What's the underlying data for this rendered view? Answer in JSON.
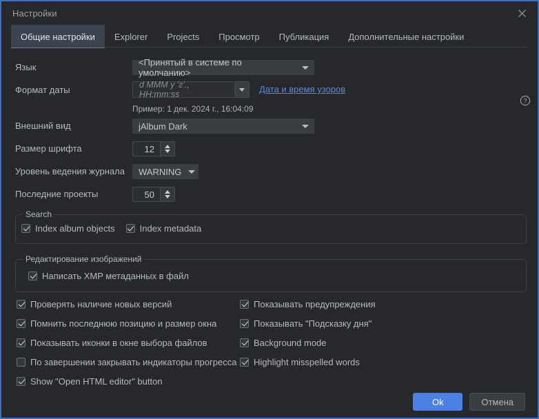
{
  "window": {
    "title": "Настройки",
    "close_icon": "close-icon",
    "help_icon": "help-circle-icon",
    "accent_color": "#4d80e4",
    "background_color": "#26282c",
    "border_color": "#3d6fc4"
  },
  "tabs": [
    {
      "label": "Общие настройки",
      "active": true
    },
    {
      "label": "Explorer",
      "active": false
    },
    {
      "label": "Projects",
      "active": false
    },
    {
      "label": "Просмотр",
      "active": false
    },
    {
      "label": "Публикация",
      "active": false
    },
    {
      "label": "Дополнительные настройки",
      "active": false
    }
  ],
  "fields": {
    "language": {
      "label": "Язык",
      "value": "<Принятый в системе по умолчанию>"
    },
    "date_format": {
      "label": "Формат даты",
      "value": "d MMM y 'г'., HH:mm:ss",
      "link": "Дата и время узоров",
      "example": "Пример: 1 дек. 2024 г., 16:04:09"
    },
    "look_and_feel": {
      "label": "Внешний вид",
      "value": "jAlbum Dark"
    },
    "font_size": {
      "label": "Размер шрифта",
      "value": "12"
    },
    "log_level": {
      "label": "Уровень ведения журнала",
      "value": "WARNING"
    },
    "recent_projects": {
      "label": "Последние проекты",
      "value": "50"
    }
  },
  "search_group": {
    "title": "Search",
    "items": [
      {
        "label": "Index album objects",
        "checked": true
      },
      {
        "label": "Index metadata",
        "checked": true
      }
    ]
  },
  "image_editing_group": {
    "title": "Редактирование изображений",
    "items": [
      {
        "label": "Написать XMP метаданных в файл",
        "checked": true
      }
    ]
  },
  "options_left": [
    {
      "label": "Проверять наличие новых версий",
      "checked": true
    },
    {
      "label": "Помнить последнюю позицию и размер окна",
      "checked": true
    },
    {
      "label": "Показывать иконки в окне выбора файлов",
      "checked": true
    },
    {
      "label": "По завершении закрывать индикаторы прогресса",
      "checked": false
    },
    {
      "label": "Show \"Open HTML editor\" button",
      "checked": true
    }
  ],
  "options_right": [
    {
      "label": "Показывать предупреждения",
      "checked": true
    },
    {
      "label": "Показывать \"Подсказку дня\"",
      "checked": true
    },
    {
      "label": "Background mode",
      "checked": true
    },
    {
      "label": "Highlight misspelled words",
      "checked": true
    }
  ],
  "buttons": {
    "ok": "Ok",
    "cancel": "Отмена"
  }
}
